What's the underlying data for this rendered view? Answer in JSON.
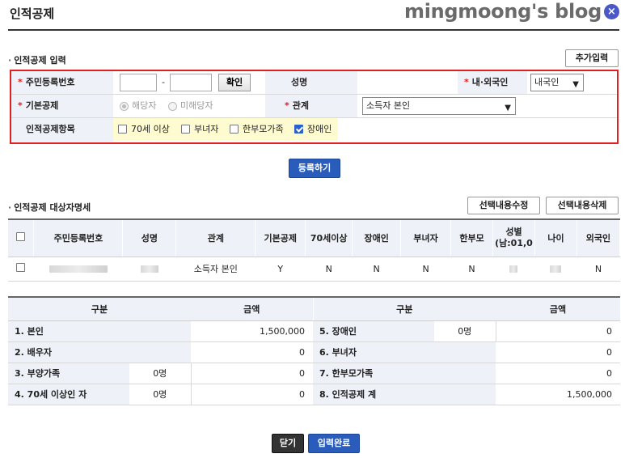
{
  "header": {
    "title": "인적공제",
    "brand": "mingmoong's blog",
    "close": "×"
  },
  "input_section": {
    "title": "인적공제 입력",
    "add_button": "추가입력",
    "rrn_label": "주민등록번호",
    "rrn_front": "",
    "rrn_dash": "-",
    "rrn_back": "",
    "confirm_button": "확인",
    "name_label": "성명",
    "name_value": "",
    "nationality_label": "내·외국인",
    "nationality_value": "내국인",
    "basic_label": "기본공제",
    "basic_opt_yes": "해당자",
    "basic_opt_no": "미해당자",
    "relation_label": "관계",
    "relation_value": "소득자 본인",
    "items_label": "인적공제항목",
    "items": [
      {
        "label": "70세 이상",
        "checked": false
      },
      {
        "label": "부녀자",
        "checked": false
      },
      {
        "label": "한부모가족",
        "checked": false
      },
      {
        "label": "장애인",
        "checked": true
      }
    ]
  },
  "register_button": "등록하기",
  "list_section": {
    "title": "인적공제 대상자명세",
    "edit_button": "선택내용수정",
    "delete_button": "선택내용삭제",
    "columns": [
      "주민등록번호",
      "성명",
      "관계",
      "기본공제",
      "70세이상",
      "장애인",
      "부녀자",
      "한부모",
      "성별\n(남:01,0",
      "나이",
      "외국인"
    ],
    "row": {
      "relation": "소득자 본인",
      "basic": "Y",
      "over70": "N",
      "disabled": "N",
      "woman": "N",
      "single": "N",
      "foreign": "N"
    }
  },
  "summary": {
    "col_category": "구분",
    "col_amount": "금액",
    "rows": [
      {
        "l_label": "1. 본인",
        "l_count": "",
        "l_amount": "1,500,000",
        "r_label": "5. 장애인",
        "r_count": "0명",
        "r_amount": "0"
      },
      {
        "l_label": "2. 배우자",
        "l_count": "",
        "l_amount": "0",
        "r_label": "6. 부녀자",
        "r_count": "",
        "r_amount": "0"
      },
      {
        "l_label": "3. 부양가족",
        "l_count": "0명",
        "l_amount": "0",
        "r_label": "7. 한부모가족",
        "r_count": "",
        "r_amount": "0"
      },
      {
        "l_label": "4. 70세 이상인 자",
        "l_count": "0명",
        "l_amount": "0",
        "r_label": "8. 인적공제 계",
        "r_count": "",
        "r_amount": "1,500,000"
      }
    ]
  },
  "footer": {
    "close_button": "닫기",
    "complete_button": "입력완료"
  }
}
